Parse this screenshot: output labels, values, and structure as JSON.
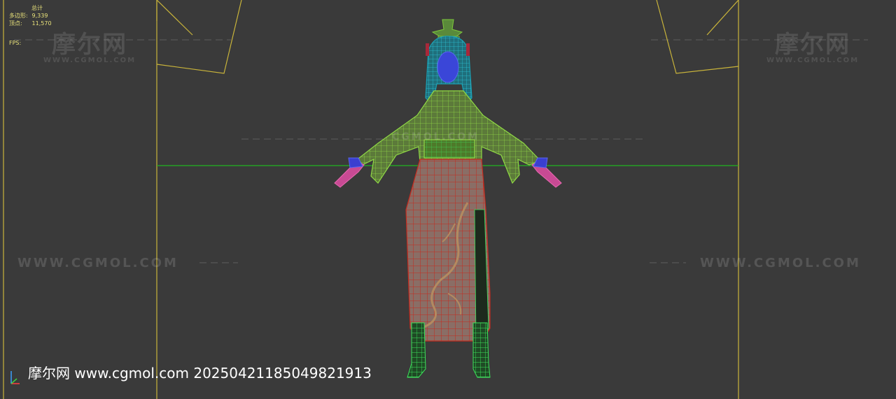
{
  "stats": {
    "header": "总计",
    "polys_label": "多边形:",
    "polys_value": "9,339",
    "verts_label": "顶点:",
    "verts_value": "11,570",
    "fps_label": "FPS:"
  },
  "watermark": {
    "logo_text": "摩尔网",
    "logo_sub": "WWW.CGMOL.COM",
    "url_text": "WWW.CGMOL.COM",
    "mid_text": "CGMOL.COM"
  },
  "footer": {
    "text": "摩尔网 www.cgmol.com 20250421185049821913"
  },
  "colors": {
    "background": "#3a3a3a",
    "frame_lines": "#c9b43a",
    "horizon": "#22b422",
    "stats_text": "#e9e27a",
    "hair": "#1aa0b4",
    "face": "#3a46d8",
    "top_wire": "#7ec83c",
    "skirt_wire": "#c42a1e",
    "hand": "#e86ab0",
    "boots": "#3ce05a"
  }
}
